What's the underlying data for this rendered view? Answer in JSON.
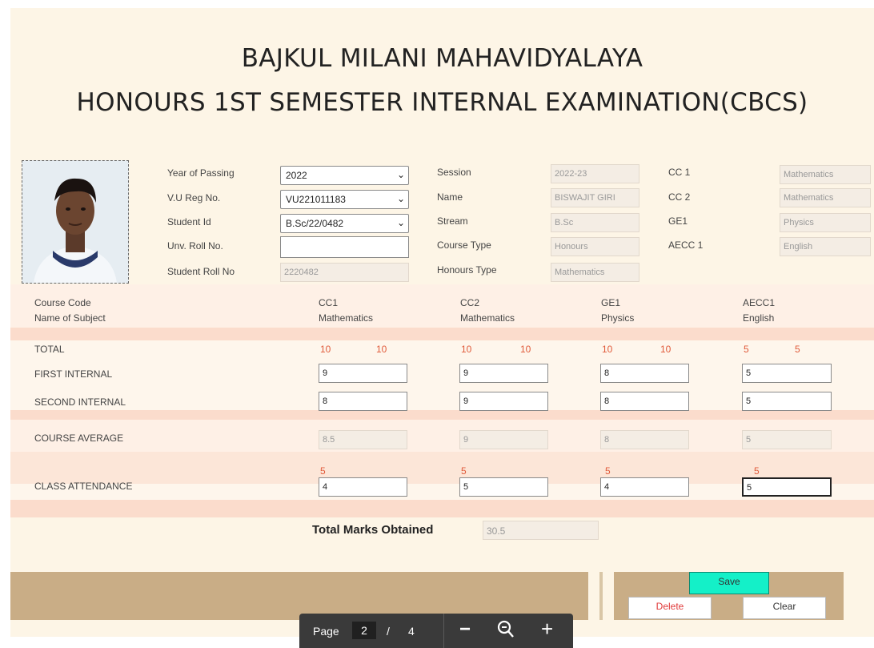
{
  "header": {
    "college": "BAJKUL MILANI MAHAVIDYALAYA",
    "exam": "HONOURS 1ST SEMESTER INTERNAL EXAMINATION(CBCS)"
  },
  "student": {
    "labels": {
      "year_of_passing": "Year of Passing",
      "vu_reg": "V.U Reg No.",
      "student_id": "Student Id",
      "unv_roll": "Unv. Roll No.",
      "student_roll": "Student Roll No"
    },
    "year_of_passing": "2022",
    "vu_reg": "VU221011183",
    "student_id": "B.Sc/22/0482",
    "unv_roll": "",
    "student_roll": "2220482"
  },
  "info": {
    "labels": {
      "session": "Session",
      "name": "Name",
      "stream": "Stream",
      "course_type": "Course Type",
      "honours_type": "Honours Type"
    },
    "session": "2022-23",
    "name": "BISWAJIT GIRI",
    "stream": "B.Sc",
    "course_type": "Honours",
    "honours_type": "Mathematics"
  },
  "courses": {
    "cc1_label": "CC 1",
    "cc1": "Mathematics",
    "cc2_label": "CC 2",
    "cc2": "Mathematics",
    "ge1_label": "GE1",
    "ge1": "Physics",
    "aecc1_label": "AECC 1",
    "aecc1": "English"
  },
  "marks": {
    "row_labels": {
      "course_code": "Course Code",
      "subject": "Name of Subject",
      "total": "TOTAL",
      "first": "FIRST INTERNAL",
      "second": "SECOND INTERNAL",
      "average": "COURSE AVERAGE",
      "attendance": "CLASS ATTENDANCE"
    },
    "columns": [
      {
        "code": "CC1",
        "subject": "Mathematics",
        "total_a": "10",
        "total_b": "10",
        "first": "9",
        "second": "8",
        "average": "8.5",
        "att_max": "5",
        "attendance": "4"
      },
      {
        "code": "CC2",
        "subject": "Mathematics",
        "total_a": "10",
        "total_b": "10",
        "first": "9",
        "second": "9",
        "average": "9",
        "att_max": "5",
        "attendance": "5"
      },
      {
        "code": "GE1",
        "subject": "Physics",
        "total_a": "10",
        "total_b": "10",
        "first": "8",
        "second": "8",
        "average": "8",
        "att_max": "5",
        "attendance": "4"
      },
      {
        "code": "AECC1",
        "subject": "English",
        "total_a": "5",
        "total_b": "5",
        "first": "5",
        "second": "5",
        "average": "5",
        "att_max": "5",
        "attendance": "5"
      }
    ]
  },
  "total": {
    "label": "Total Marks Obtained",
    "value": "30.5"
  },
  "actions": {
    "save": "Save",
    "delete": "Delete",
    "clear": "Clear"
  },
  "pager": {
    "label": "Page",
    "current": "2",
    "separator": "/",
    "total": "4",
    "zoom_out": "−",
    "zoom_in": "+"
  },
  "colors": {
    "page_bg": "#fdf5e6",
    "band": "#fbdccc",
    "action_bar": "#c9ad86",
    "save_button": "#14f0c8",
    "delete_text": "#e03a3a",
    "number_red": "#e05a3a"
  }
}
